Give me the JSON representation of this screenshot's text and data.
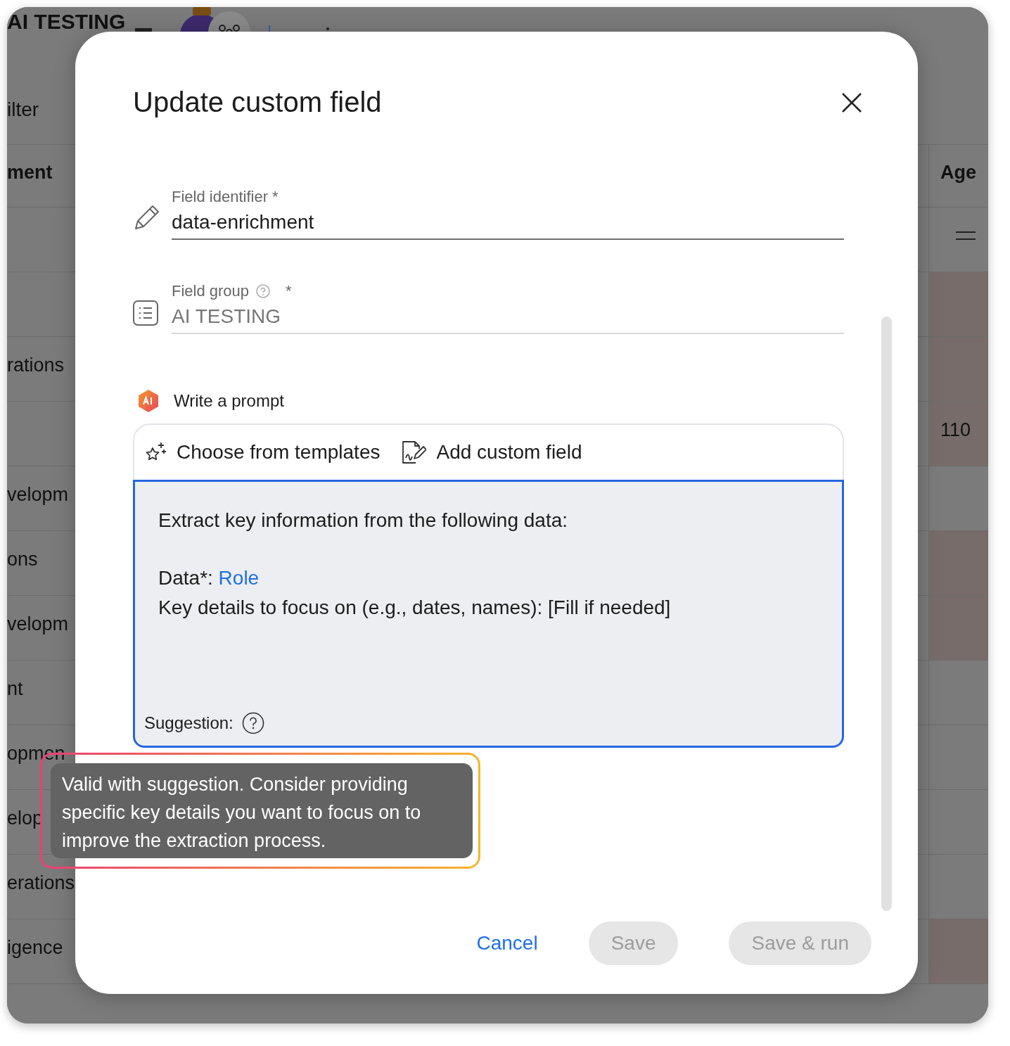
{
  "background": {
    "app_title": "AI TESTING",
    "filter_label": "ilter",
    "column_header": "ment",
    "age_header": "Age",
    "rows": [
      {},
      {
        "name": "rations"
      },
      {
        "age": "110"
      },
      {
        "name": "velopm"
      },
      {
        "name": "ons"
      },
      {
        "name": "velopm"
      },
      {
        "name": "nt"
      },
      {
        "name": "opmen"
      },
      {
        "name": "elop"
      },
      {
        "name": "erations"
      },
      {
        "name": "igence"
      }
    ]
  },
  "dialog": {
    "title": "Update custom field",
    "fields": [
      {
        "kind": "text",
        "label": "Field identifier *",
        "value": "data-enrichment",
        "disabled": false
      },
      {
        "kind": "group",
        "label": "Field group",
        "required_mark": "*",
        "value": "AI TESTING",
        "disabled": true
      }
    ],
    "prompt": {
      "heading": "Write a prompt",
      "actions": [
        "Choose from templates",
        "Add custom field"
      ],
      "paragraphs": [
        [
          {
            "kind": "text",
            "text": "Extract key information from the following data:"
          }
        ],
        [
          {
            "kind": "variable",
            "label": "Data*:",
            "variable": "Role"
          },
          {
            "kind": "text",
            "text": "Key details to focus on (e.g., dates, names): [Fill if needed]"
          }
        ]
      ],
      "suggestion_label": "Suggestion:"
    },
    "tooltip": "Valid with suggestion. Consider providing specific key details you want to focus on to improve the extraction process.",
    "buttons": [
      {
        "kind": "link",
        "label": "Cancel",
        "disabled": false
      },
      {
        "kind": "filled",
        "label": "Save",
        "disabled": true
      },
      {
        "kind": "filled",
        "label": "Save & run",
        "disabled": true
      }
    ]
  }
}
